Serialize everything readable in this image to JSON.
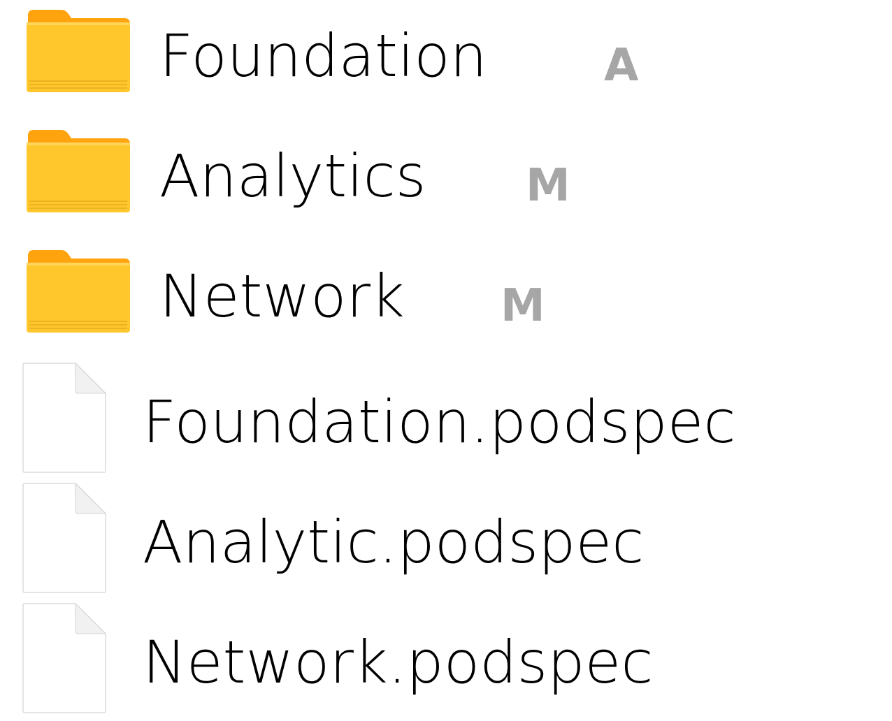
{
  "colors": {
    "folder_front": "#FFC72C",
    "folder_back": "#FFA30F",
    "folder_line": "#E5AC1E",
    "badge": "#A6A6A6",
    "text": "#000000"
  },
  "items": [
    {
      "type": "folder",
      "icon": "folder-icon",
      "name": "Foundation",
      "status": "A"
    },
    {
      "type": "folder",
      "icon": "folder-icon",
      "name": "Analytics",
      "status": "M"
    },
    {
      "type": "folder",
      "icon": "folder-icon",
      "name": "Network",
      "status": "M"
    },
    {
      "type": "file",
      "icon": "document-icon",
      "name": "Foundation.podspec"
    },
    {
      "type": "file",
      "icon": "document-icon",
      "name": "Analytic.podspec"
    },
    {
      "type": "file",
      "icon": "document-icon",
      "name": "Network.podspec"
    }
  ]
}
